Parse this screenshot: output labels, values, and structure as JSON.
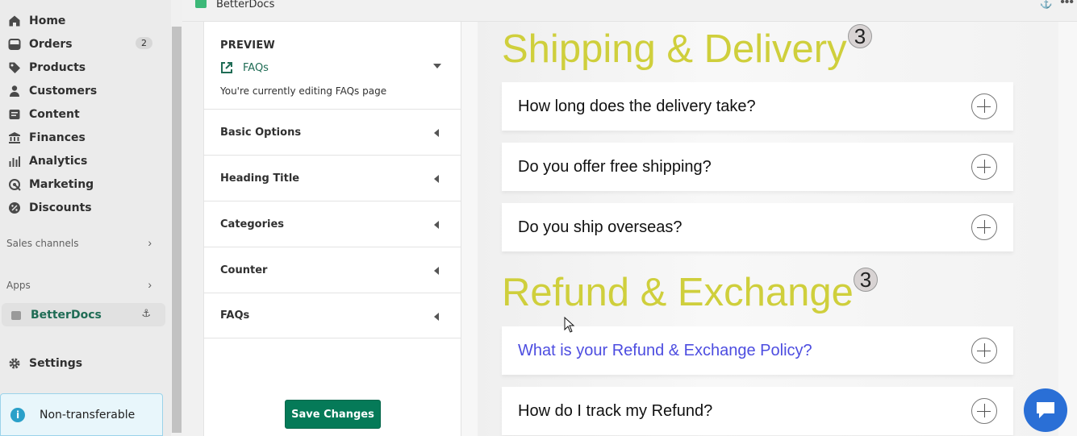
{
  "nav": {
    "items": [
      {
        "label": "Home",
        "icon": "home-icon"
      },
      {
        "label": "Orders",
        "icon": "orders-icon",
        "badge": "2"
      },
      {
        "label": "Products",
        "icon": "tag-icon"
      },
      {
        "label": "Customers",
        "icon": "person-icon"
      },
      {
        "label": "Content",
        "icon": "content-icon"
      },
      {
        "label": "Finances",
        "icon": "bank-icon"
      },
      {
        "label": "Analytics",
        "icon": "bar-chart-icon"
      },
      {
        "label": "Marketing",
        "icon": "marketing-icon"
      },
      {
        "label": "Discounts",
        "icon": "discount-icon"
      }
    ],
    "sales_channels": "Sales channels",
    "apps": "Apps",
    "active_app": "BetterDocs",
    "settings": "Settings",
    "notice": "Non-transferable"
  },
  "topbar": {
    "app_title": "BetterDocs"
  },
  "panel": {
    "preview_label": "PREVIEW",
    "preview_page": "FAQs",
    "preview_note": "You're currently editing FAQs page",
    "sections": [
      "Basic Options",
      "Heading Title",
      "Categories",
      "Counter",
      "FAQs"
    ],
    "save_label": "Save Changes"
  },
  "preview": {
    "categories": [
      {
        "title": "Shipping & Delivery",
        "count": "3",
        "faqs": [
          "How long does the delivery take?",
          "Do you offer free shipping?",
          "Do you ship overseas?"
        ]
      },
      {
        "title": "Refund & Exchange",
        "count": "3",
        "faqs": [
          "What is your Refund & Exchange Policy?",
          "How do I track my Refund?"
        ]
      }
    ],
    "colors": {
      "title": "#cfcf3c",
      "active_question": "#4d4de0",
      "save_button": "#057a58",
      "chat_button": "#2a6fd6"
    }
  }
}
